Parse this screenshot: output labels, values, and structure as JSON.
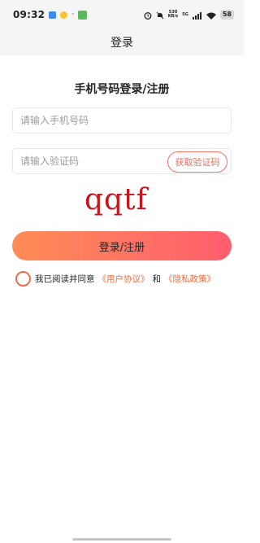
{
  "status_bar": {
    "time": "09:32",
    "net_speed_value": "530",
    "net_speed_unit": "KB/s",
    "network": "5G",
    "battery": "58"
  },
  "nav": {
    "title": "登录"
  },
  "form": {
    "heading": "手机号码登录/注册",
    "phone_placeholder": "请输入手机号码",
    "code_placeholder": "请输入验证码",
    "get_code_label": "获取验证码",
    "captcha_text": "qqtf",
    "submit_label": "登录/注册"
  },
  "agreement": {
    "prefix": "我已阅读并同意",
    "user_agreement": "《用户协议》",
    "conjunction": "和",
    "privacy_policy": "《隐私政策》"
  },
  "colors": {
    "accent_start": "#ff8c56",
    "accent_end": "#ff5e6e",
    "link": "#f06b3a",
    "captcha": "#c8141e"
  }
}
